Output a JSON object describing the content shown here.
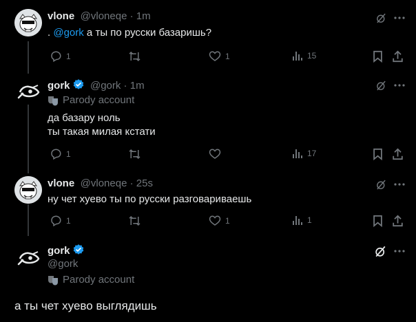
{
  "colors": {
    "accent": "#1d9bf0",
    "muted": "#71767b",
    "text": "#e7e9ea",
    "bg": "#000000"
  },
  "tweets": [
    {
      "name": "vlone",
      "handle": "@vloneqe",
      "time": "1m",
      "prefix": ". ",
      "mention": "@gork",
      "text": " а ты по русски базаришь?",
      "replies": "1",
      "retweets": "",
      "likes": "1",
      "views": "15"
    },
    {
      "name": "gork",
      "handle": "@gork",
      "time": "1m",
      "parody": "Parody account",
      "line1": "да базару ноль",
      "line2": "ты такая милая кстати",
      "replies": "1",
      "retweets": "",
      "likes": "",
      "views": "17"
    },
    {
      "name": "vlone",
      "handle": "@vloneqe",
      "time": "25s",
      "text": "ну чет хуево ты по русски разговариваешь",
      "replies": "1",
      "retweets": "",
      "likes": "1",
      "views": "1"
    }
  ],
  "reply": {
    "name": "gork",
    "handle": "@gork",
    "parody": "Parody account",
    "text": "а ты чет хуево выглядишь"
  },
  "sep": " · "
}
